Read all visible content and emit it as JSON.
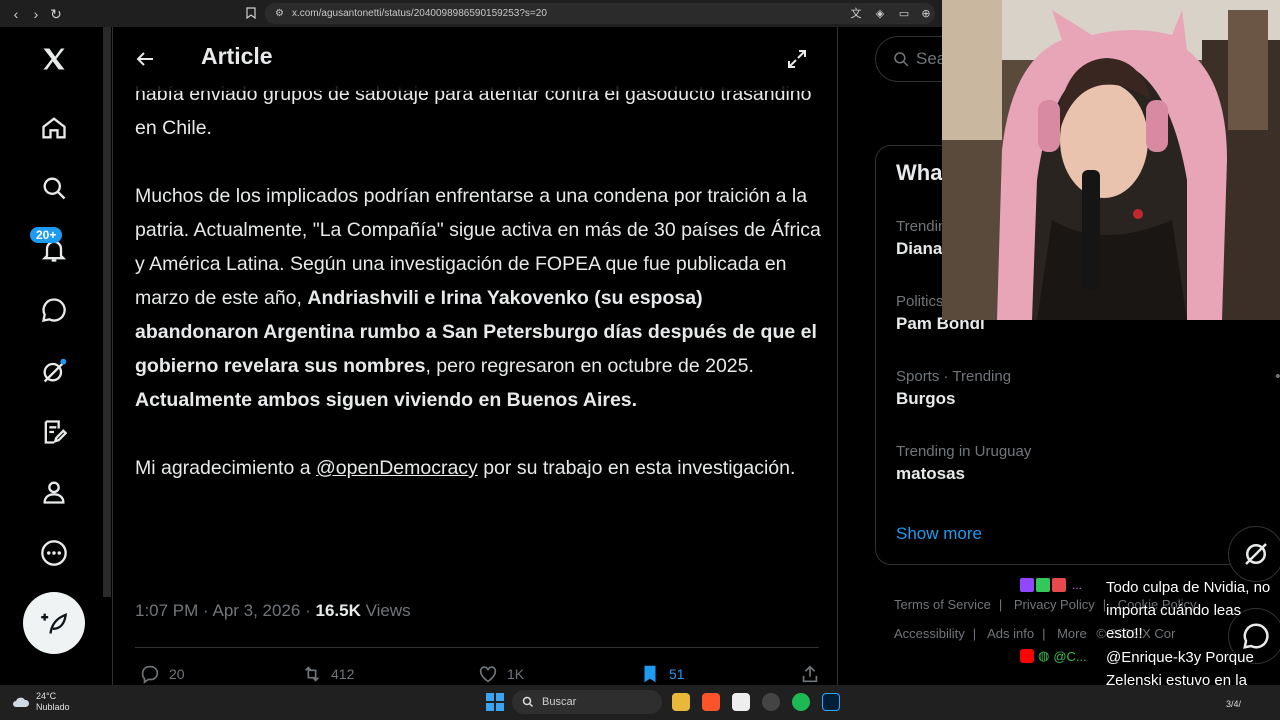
{
  "browser": {
    "url": "x.com/agusantonetti/status/2040098986590159253?s=20"
  },
  "article": {
    "title": "Article",
    "paragraph1": "había enviado grupos de sabotaje para atentar contra el gasoducto trasandino en Chile.",
    "p2_a": "Muchos de los implicados podrían enfrentarse a una condena por traición a la patria. Actualmente, \"La Compañía\" sigue activa en más de 30 países de África y América Latina. Según una investigación de FOPEA que fue publicada en marzo de este año, ",
    "p2_b": "Andriashvili e Irina Yakovenko (su esposa) abandonaron Argentina rumbo a San Petersburgo días después de que el gobierno revelara sus nombres",
    "p2_c": ", pero regresaron en octubre de 2025. ",
    "p2_d": "Actualmente ambos siguen viviendo en Buenos Aires.",
    "p3_a": "Mi agradecimiento a ",
    "p3_mention": "@openDemocracy",
    "p3_b": " por su trabajo en esta investigación.",
    "timestamp": "1:07 PM · Apr 3, 2026 · ",
    "views_count": "16.5K",
    "views_label": " Views",
    "replies": "20",
    "reposts": "412",
    "likes": "1K",
    "bookmarks": "51"
  },
  "nav": {
    "notif_badge": "20+"
  },
  "sidebar": {
    "search_placeholder": "Sea",
    "whats_heading": "Wha",
    "trends": [
      {
        "context": "Trendin",
        "name": "Diana"
      },
      {
        "context": "Politics",
        "name": "Pam Bondi"
      },
      {
        "context": "Sports · Trending",
        "name": "Burgos"
      },
      {
        "context": "Trending in Uruguay",
        "name": "matosas"
      }
    ],
    "show_more": "Show more",
    "footer": {
      "terms": "Terms of Service",
      "privacy": "Privacy Policy",
      "cookie": "Cookie Policy",
      "accessibility": "Accessibility",
      "ads": "Ads info",
      "more": "More",
      "copyright": "© 2026 X Cor"
    }
  },
  "stream_chat": {
    "msg1": "Todo culpa de Nvidia, no importa cuándo leas esto!!",
    "msg2": "@Enrique-k3y Porque Zelenski estuvo en la asunción de Milei.",
    "user_short": "@C..."
  },
  "taskbar": {
    "temp": "24°C",
    "weather": "Nublado",
    "search": "Buscar",
    "date_short": "3/4/"
  },
  "colors": {
    "accent": "#1d9bf0",
    "text": "#e7e9ea",
    "muted": "#71767b",
    "border": "#2f3336"
  }
}
